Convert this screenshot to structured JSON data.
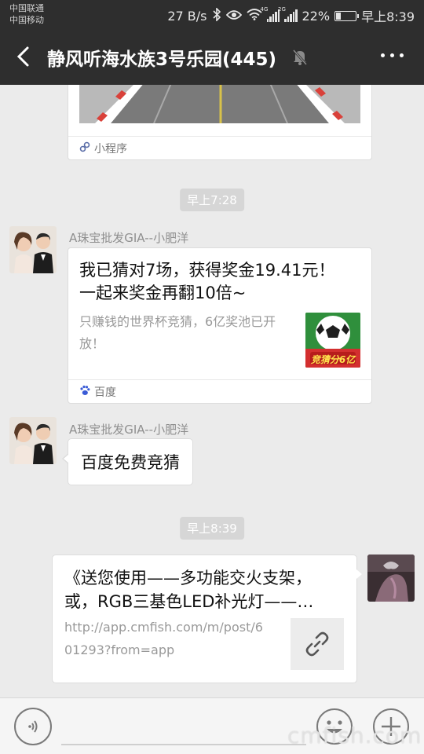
{
  "status_bar": {
    "carrier_1": "中国联通",
    "carrier_2": "中国移动",
    "speed": "27 B/s",
    "net_4g": "4G",
    "net_2g": "2G",
    "battery_text": "22%",
    "battery_level": 0.22,
    "time": "早上8:39"
  },
  "header": {
    "title": "静风听海水族3号乐园(445)",
    "back_icon": "chevron-left-icon",
    "mute_icon": "bell-off-icon",
    "more_icon": "more-icon"
  },
  "messages": {
    "mini_program_card": {
      "source_label": "小程序"
    },
    "time_1": "早上7:28",
    "msg_1": {
      "sender": "A珠宝批发GIA--小肥洋",
      "title": "我已猜对7场，获得奖金19.41元！一起来奖金再翻10倍~",
      "description": "只赚钱的世界杯竞猜，6亿奖池已开放！",
      "thumb_caption": "竞猜分6亿",
      "source_label": "百度"
    },
    "msg_2": {
      "sender": "A珠宝批发GIA--小肥洋",
      "text": "百度免费竞猜"
    },
    "time_2": "早上8:39",
    "msg_3": {
      "title": "《送您使用——多功能交火支架，或，RGB三基色LED补光灯——…",
      "url": "http://app.cmfish.com/m/post/601293?from=app"
    }
  },
  "input_bar": {
    "voice_icon": "voice-icon",
    "emoji_icon": "emoji-icon",
    "plus_icon": "plus-icon"
  },
  "watermark": "cmfish.com",
  "colors": {
    "header_bg": "#2e2e2e",
    "chat_bg": "#ebebeb",
    "time_pill_bg": "#d6d6d6"
  }
}
